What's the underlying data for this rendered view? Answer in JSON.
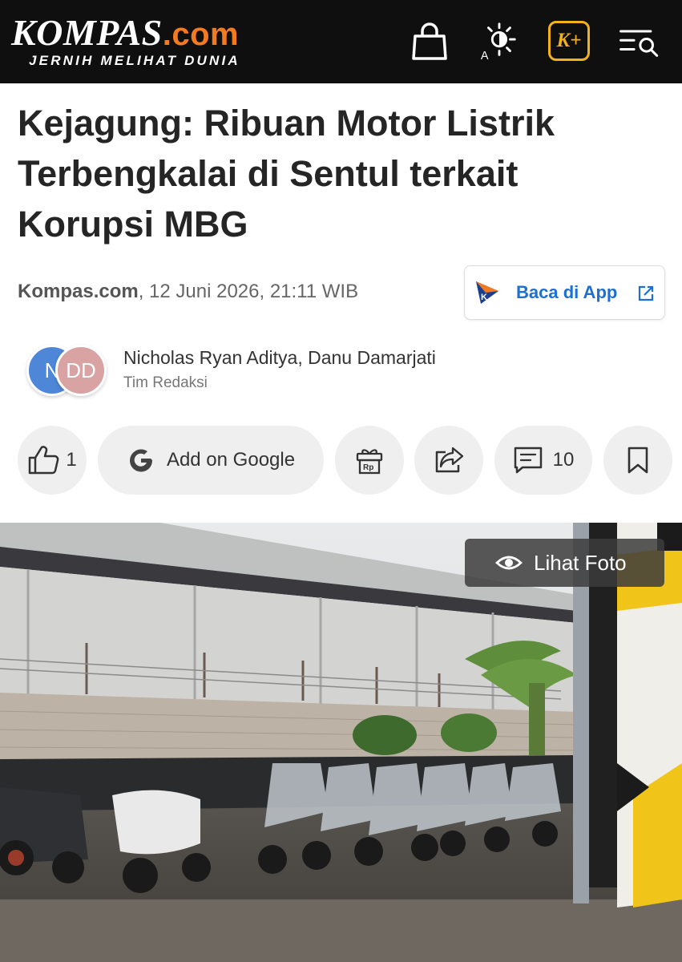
{
  "header": {
    "logo_main": "KOMPAS",
    "logo_suffix": ".com",
    "tagline": "JERNIH MELIHAT DUNIA",
    "kplus_label": "K+"
  },
  "article": {
    "title": "Kejagung: Ribuan Motor Listrik Terbengkalai di Sentul terkait Korupsi MBG",
    "source": "Kompas.com",
    "datetime": ", 12 Juni 2026, 21:11 WIB",
    "app_button_label": "Baca di App",
    "authors": "Nicholas Ryan Aditya,  Danu Damarjati",
    "author_initials": [
      "N",
      "DD"
    ],
    "team_label": "Tim Redaksi"
  },
  "actions": {
    "like_count": "1",
    "google_label": "Add on Google",
    "comment_count": "10"
  },
  "photo": {
    "view_label": "Lihat Foto"
  },
  "colors": {
    "header_bg": "#0f0f0f",
    "brand_orange": "#f47a20",
    "kplus_gold": "#f2b21b",
    "app_link_blue": "#1d6fd2"
  },
  "icons": [
    "bag-icon",
    "brightness-icon",
    "kplus-icon",
    "menu-search-icon",
    "kompas-app-icon",
    "external-link-icon",
    "thumbs-up-icon",
    "google-icon",
    "gift-rp-icon",
    "share-icon",
    "comment-icon",
    "bookmark-icon",
    "eye-icon"
  ]
}
